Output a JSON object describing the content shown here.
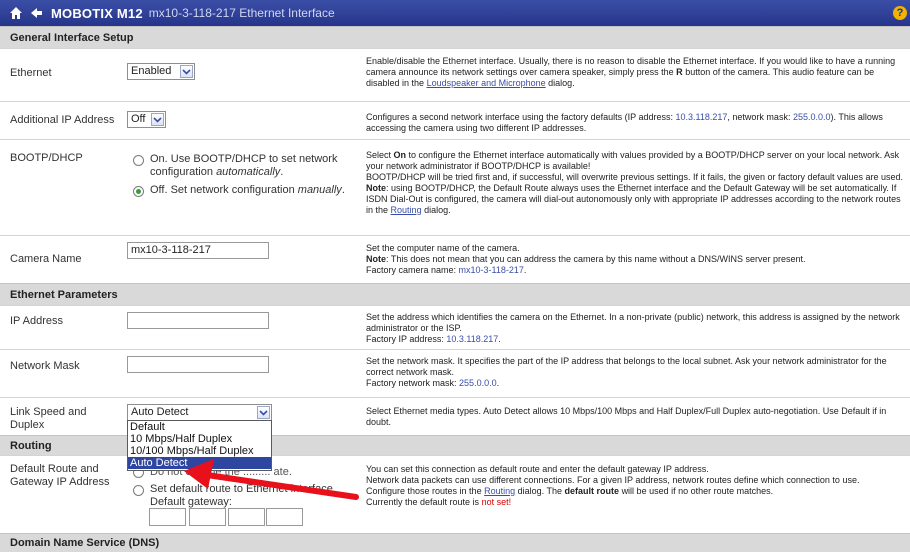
{
  "header": {
    "brand": "MOBOTIX M12",
    "page_title": "mx10-3-118-217 Ethernet Interface",
    "help": "?"
  },
  "sections": {
    "general": "General Interface Setup",
    "ethernet_params": "Ethernet Parameters",
    "routing": "Routing",
    "dns": "Domain Name Service (DNS)"
  },
  "ethernet": {
    "label": "Ethernet",
    "value": "Enabled",
    "desc_1": "Enable/disable the Ethernet interface. Usually, there is no reason to disable the Ethernet interface. If you would like to have a running camera announce its network settings over camera speaker, simply press the",
    "desc_key": "R",
    "desc_2": "button of the camera. This audio feature can be disabled in the",
    "desc_link": "Loudspeaker and Microphone",
    "desc_3": "dialog."
  },
  "additional_ip": {
    "label": "Additional IP Address",
    "value": "Off",
    "desc_1": "Configures a second network interface using the factory defaults (IP address:",
    "desc_ip": "10.3.118.217",
    "desc_2": ", network mask:",
    "desc_mask": "255.0.0.0",
    "desc_3": "). This allows accessing the camera using two different IP addresses."
  },
  "bootp": {
    "label": "BOOTP/DHCP",
    "option_on_line1": "On. Use BOOTP/DHCP to set network",
    "option_on_line2_pre": "configuration",
    "option_on_line2_em": "automatically",
    "option_off_pre": "Off. Set network configuration",
    "option_off_em": "manually",
    "selected": "off",
    "desc_select": "Select",
    "desc_on": "On",
    "desc_1": "to configure the Ethernet interface automatically with values provided by a BOOTP/DHCP server on your local network. Ask your network administrator if BOOTP/DHCP is available!",
    "desc_2": "BOOTP/DHCP will be tried first and, if successful, will overwrite previous settings. If it fails, the given or factory default values are used.",
    "desc_note": "Note",
    "desc_3": ": using BOOTP/DHCP, the Default Route always uses the Ethernet interface and the Default Gateway will be set automatically. If ISDN Dial-Out is configured, the camera will dial-out autonomously only with appropriate IP addresses according to the network routes in the",
    "desc_link": "Routing",
    "desc_4": "dialog."
  },
  "camera_name": {
    "label": "Camera Name",
    "value": "mx10-3-118-217",
    "desc_1": "Set the computer name of the camera.",
    "desc_note": "Note",
    "desc_2": ": This does not mean that you can address the camera by this name without a DNS/WINS server present.",
    "desc_3": "Factory camera name:",
    "desc_default": "mx10-3-118-217"
  },
  "ip_address": {
    "label": "IP Address",
    "value": "",
    "desc_1": "Set the address which identifies the camera on the Ethernet. In a non-private (public) network, this address is assigned by the network administrator or the ISP.",
    "desc_2": "Factory IP address:",
    "desc_default": "10.3.118.217"
  },
  "network_mask": {
    "label": "Network Mask",
    "value": "",
    "desc_1": "Set the network mask. It specifies the part of the IP address that belongs to the local subnet. Ask your network administrator for the correct network mask.",
    "desc_2": "Factory network mask:",
    "desc_default": "255.0.0.0"
  },
  "link_speed": {
    "label_line1": "Link Speed and",
    "label_line2": "Duplex",
    "value": "Auto Detect",
    "options": [
      "Default",
      "10 Mbps/Half Duplex",
      "10/100 Mbps/Half Duplex",
      "Auto Detect"
    ],
    "desc": "Select Ethernet media types. Auto Detect allows 10 Mbps/100 Mbps and Half Duplex/Full Duplex auto-negotiation. Use Default if in doubt."
  },
  "default_route": {
    "label_line1": "Default Route and",
    "label_line2": "Gateway IP Address",
    "option_hidden_pre": "Do not change the",
    "option_hidden_post": "ate.",
    "option_set_line1": "Set default route to Ethernet interface",
    "option_set_line2": "Default gateway:",
    "desc_1": "You can set this connection as default route and enter the default gateway IP address.",
    "desc_2": "Network data packets can use different connections. For a given IP address, network routes define which connection to use.",
    "desc_3": "Configure those routes in the",
    "desc_link": "Routing",
    "desc_4": "dialog. The",
    "desc_bold": "default route",
    "desc_5": "will be used if no other route matches.",
    "desc_6": "Currently the default route is",
    "desc_status": "not set!"
  },
  "colors": {
    "header_bg": "#2e3d94",
    "section_bg": "#d9d9d9",
    "link": "#3a4ea8",
    "alert": "#d60000",
    "arrow": "#e8101a",
    "selected_option": "#2f46a0"
  }
}
